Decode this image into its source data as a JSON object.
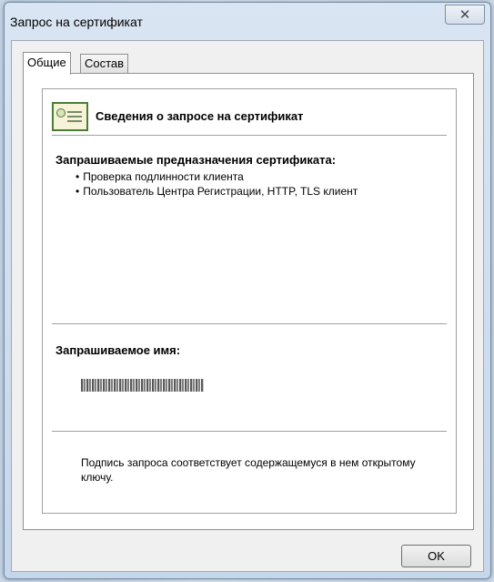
{
  "window": {
    "title": "Запрос на сертификат",
    "close_glyph": "✕"
  },
  "tabs": [
    {
      "label": "Общие",
      "active": true
    },
    {
      "label": "Состав",
      "active": false
    }
  ],
  "general": {
    "heading": "Сведения о запросе на сертификат",
    "purposes_label": "Запрашиваемые предназначения сертификата:",
    "purposes": [
      "Проверка подлинности клиента",
      "Пользователь Центра Регистрации, HTTP, TLS клиент"
    ],
    "requested_name_label": "Запрашиваемое имя:",
    "signature_note": "Подпись запроса соответствует содержащемуся в нем открытому ключу."
  },
  "buttons": {
    "ok": "OK"
  },
  "icons": {
    "certificate": "certificate-icon",
    "close": "close-icon"
  }
}
